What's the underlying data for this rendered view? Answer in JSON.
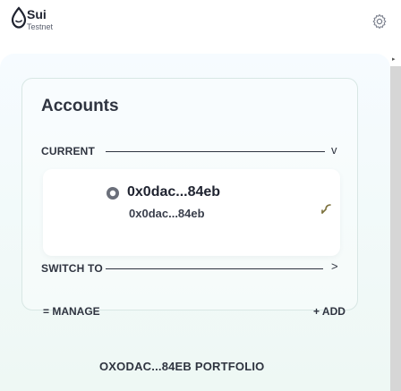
{
  "header": {
    "brand": "Sui",
    "network": "Testnet",
    "settings_icon": "gear-icon"
  },
  "accounts": {
    "title": "Accounts",
    "current_label": "CURRENT",
    "current_chevron": "v",
    "account": {
      "name": "0x0dac...84eb",
      "address": "0x0dac...84eb",
      "icon": "account-icon",
      "copy_icon": "copy-icon"
    },
    "switch_label": "SWITCH TO",
    "switch_chevron": ">",
    "manage_label": "= MANAGE",
    "add_label": "+ ADD"
  },
  "portfolio_label": "OXODAC...84EB PORTFOLIO"
}
